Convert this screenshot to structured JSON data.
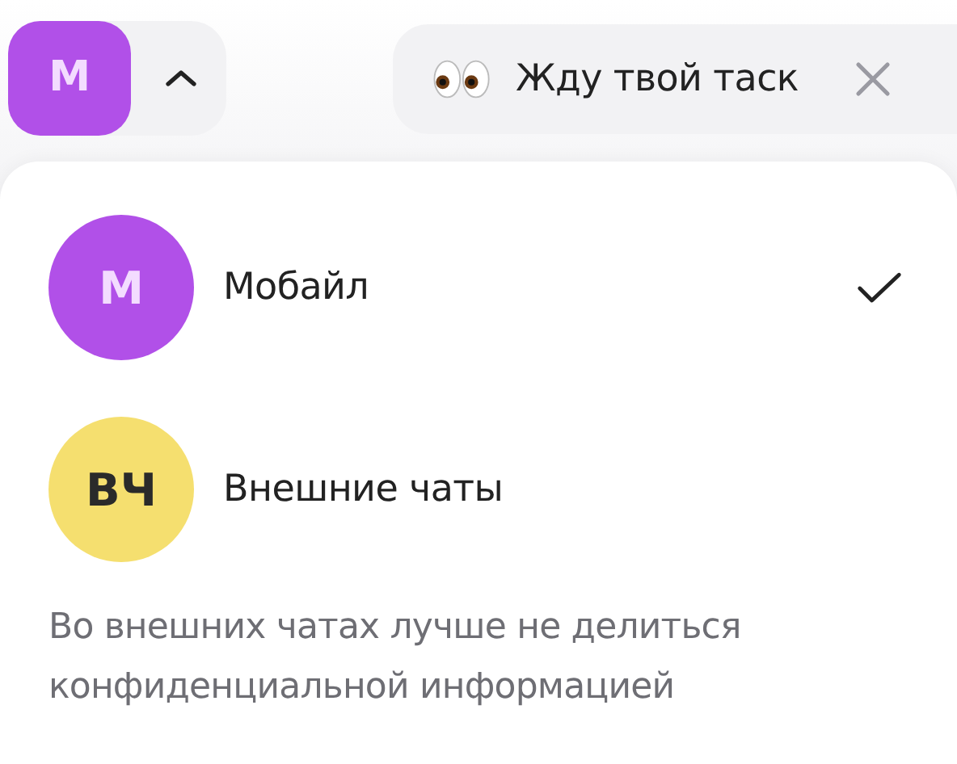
{
  "header": {
    "workspace": {
      "initial": "М",
      "color": "#b150e8",
      "expanded": true
    },
    "status": {
      "text": "Жду твой таск"
    }
  },
  "workspaces": [
    {
      "initials": "М",
      "name": "Мобайл",
      "color": "#b150e8",
      "selected": true
    },
    {
      "initials": "ВЧ",
      "name": "Внешние чаты",
      "color": "#f5df6f",
      "selected": false
    }
  ],
  "note": "Во внешних чатах лучше не делиться конфиденциальной информацией"
}
